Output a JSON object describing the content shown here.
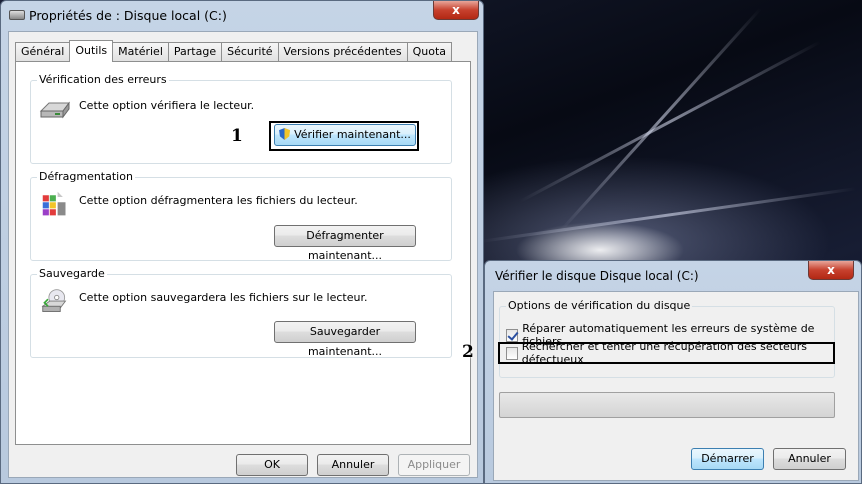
{
  "main_window": {
    "title": "Propriétés de : Disque local (C:)",
    "close_label": "x",
    "tabs": [
      {
        "label": "Général"
      },
      {
        "label": "Outils"
      },
      {
        "label": "Matériel"
      },
      {
        "label": "Partage"
      },
      {
        "label": "Sécurité"
      },
      {
        "label": "Versions précédentes"
      },
      {
        "label": "Quota"
      }
    ],
    "active_tab": "Outils",
    "groups": {
      "error_check": {
        "title": "Vérification des erreurs",
        "description": "Cette option vérifiera le lecteur.",
        "button": "Vérifier maintenant...",
        "icon": "drive-icon"
      },
      "defrag": {
        "title": "Défragmentation",
        "description": "Cette option défragmentera les fichiers du lecteur.",
        "button": "Défragmenter maintenant...",
        "icon": "defrag-icon"
      },
      "backup": {
        "title": "Sauvegarde",
        "description": "Cette option sauvegardera les fichiers sur le lecteur.",
        "button": "Sauvegarder maintenant...",
        "icon": "backup-icon"
      }
    },
    "footer": {
      "ok": "OK",
      "cancel": "Annuler",
      "apply": "Appliquer"
    }
  },
  "check_dialog": {
    "title": "Vérifier le disque Disque local (C:)",
    "close_label": "x",
    "options_title": "Options de vérification du disque",
    "options": [
      {
        "label": "Réparer automatiquement les erreurs de système de fichiers",
        "checked": true
      },
      {
        "label": "Rechercher et tenter une récupération des secteurs défectueux",
        "checked": false
      }
    ],
    "start": "Démarrer",
    "cancel": "Annuler"
  },
  "annotations": {
    "step1": "1",
    "step2": "2"
  }
}
